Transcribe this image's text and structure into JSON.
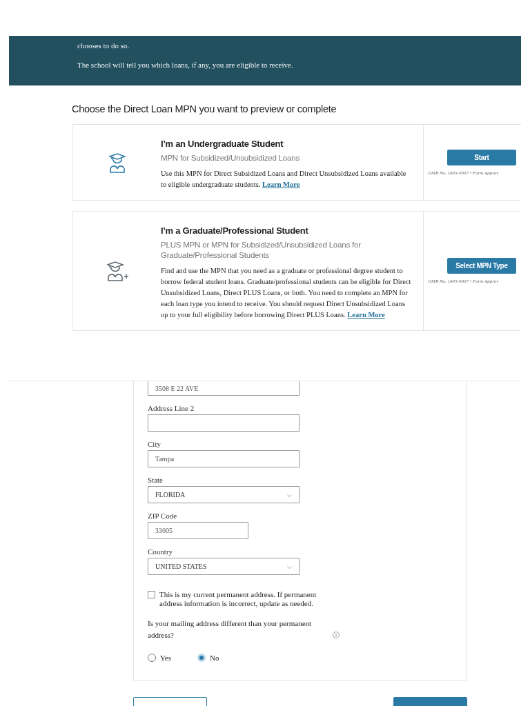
{
  "banner": {
    "paragraphs": [
      "chooses to do so.",
      "The school will tell you which loans, if any, you are eligible to receive."
    ]
  },
  "heading": "Choose the Direct Loan MPN you want to preview or complete",
  "mpn_options": [
    {
      "kind": "undergraduate",
      "title": "I’m an Undergraduate Student",
      "subtitle": "MPN for Subsidized/Unsubsidized Loans",
      "description": "Use this MPN for Direct Subsidized Loans and Direct Unsubsidized Loans available to eligible undergraduate students.",
      "link": "Learn More",
      "button": "Start",
      "omb": "OMB No. 1845-0007 • Form Approv"
    },
    {
      "kind": "graduate",
      "title": "I’m a Graduate/Professional Student",
      "subtitle": "PLUS MPN or MPN for Subsidized/Unsubsidized Loans for Graduate/Professional Students",
      "description": "Find and use the MPN that you need as a graduate or professional degree student to borrow federal student loans. Graduate/professional students can be eligible for Direct Unsubsidized Loans, Direct PLUS Loans, or both. You need to complete an MPN for each loan type you intend to receive. You should request Direct Unsubsidized Loans up to your full eligibility before borrowing Direct PLUS Loans.",
      "link": "Learn More",
      "button": "Select MPN Type",
      "omb": "OMB No. 1845-0007 • Form Approv"
    }
  ],
  "address_form": {
    "fields": [
      {
        "kind": "text",
        "value": "3508 E 22 AVE"
      },
      {
        "kind": "text",
        "label": "Address Line 2"
      },
      {
        "kind": "text",
        "label": "City",
        "value": "Tampa"
      },
      {
        "kind": "select",
        "label": "State",
        "value": "FLORIDA"
      },
      {
        "kind": "short",
        "label": "ZIP Code",
        "value": "33605"
      },
      {
        "kind": "select",
        "label": "Country",
        "value": "UNITED STATES"
      }
    ],
    "checkbox": {
      "label": "This is my current permanent address. If permanent address information is incorrect, update as needed.",
      "checked": false
    },
    "question": "Is your mailing address different than your permanent address?",
    "radios": [
      {
        "label": "Yes",
        "selected": false
      },
      {
        "label": "No",
        "selected": true
      }
    ]
  },
  "footer_buttons": [
    {
      "kind": "outline"
    },
    {
      "kind": "primary"
    }
  ]
}
